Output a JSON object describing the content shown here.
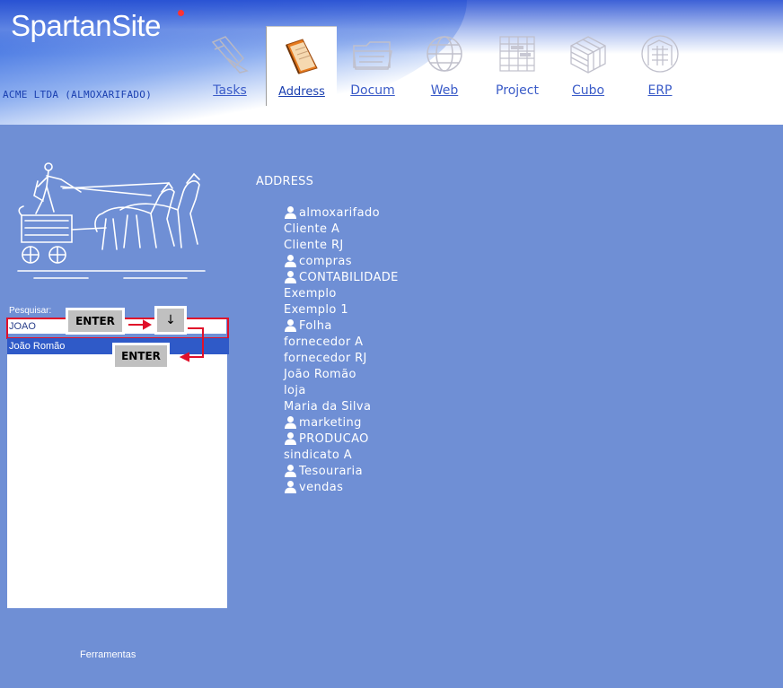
{
  "header": {
    "brand": "SpartanSite",
    "company": "ACME LTDA (ALMOXARIFADO)",
    "tabs": [
      {
        "label": "Tasks",
        "icon": "tasks-icon",
        "active": false
      },
      {
        "label": "Address",
        "icon": "address-book-icon",
        "active": true
      },
      {
        "label": "Docum",
        "icon": "folder-icon",
        "active": false
      },
      {
        "label": "Web",
        "icon": "globe-icon",
        "active": false
      },
      {
        "label": "Project",
        "icon": "project-grid-icon",
        "active": false
      },
      {
        "label": "Cubo",
        "icon": "cube-icon",
        "active": false
      },
      {
        "label": "ERP",
        "icon": "erp-building-icon",
        "active": false
      }
    ]
  },
  "sidebar": {
    "search_label": "Pesquisar:",
    "search_value": "JOAO",
    "results": [
      "João Romão"
    ],
    "annotations": {
      "enter_key_1": "ENTER",
      "down_key": "↓",
      "enter_key_2": "ENTER"
    },
    "tools_link": "Ferramentas"
  },
  "main": {
    "section_title": "ADDRESS",
    "items": [
      {
        "label": "almoxarifado",
        "group": true
      },
      {
        "label": "Cliente A",
        "group": false
      },
      {
        "label": "Cliente RJ",
        "group": false
      },
      {
        "label": "compras",
        "group": true
      },
      {
        "label": "CONTABILIDADE",
        "group": true
      },
      {
        "label": "Exemplo",
        "group": false
      },
      {
        "label": "Exemplo 1",
        "group": false
      },
      {
        "label": "Folha",
        "group": true
      },
      {
        "label": "fornecedor A",
        "group": false
      },
      {
        "label": "fornecedor RJ",
        "group": false
      },
      {
        "label": "João Romão",
        "group": false
      },
      {
        "label": "loja",
        "group": false
      },
      {
        "label": "Maria da Silva",
        "group": false
      },
      {
        "label": "marketing",
        "group": true
      },
      {
        "label": "PRODUCAO",
        "group": true
      },
      {
        "label": "sindicato A",
        "group": false
      },
      {
        "label": "Tesouraria",
        "group": true
      },
      {
        "label": "vendas",
        "group": true
      }
    ]
  },
  "colors": {
    "background": "#6f8fd5",
    "highlight_border": "#e0102a",
    "selected_row": "#2f5ac8"
  }
}
